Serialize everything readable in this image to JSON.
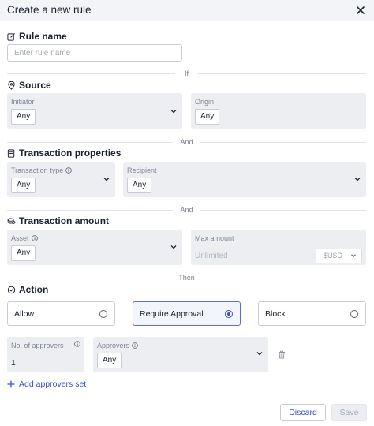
{
  "header": {
    "title": "Create a new rule"
  },
  "rule_name": {
    "title": "Rule name",
    "placeholder": "Enter rule name",
    "value": ""
  },
  "dividers": {
    "if": "If",
    "and1": "And",
    "and2": "And",
    "then": "Then"
  },
  "source": {
    "title": "Source",
    "initiator": {
      "label": "Initiator",
      "value": "Any"
    },
    "origin": {
      "label": "Origin",
      "value": "Any"
    }
  },
  "transaction_properties": {
    "title": "Transaction properties",
    "type": {
      "label": "Transaction type",
      "value": "Any"
    },
    "recipient": {
      "label": "Recipient",
      "value": "Any"
    }
  },
  "transaction_amount": {
    "title": "Transaction amount",
    "asset": {
      "label": "Asset",
      "value": "Any"
    },
    "max_amount": {
      "label": "Max amount",
      "placeholder": "Unlimited",
      "currency": "$USD"
    }
  },
  "action": {
    "title": "Action",
    "options": [
      "Allow",
      "Require Approval",
      "Block"
    ],
    "selected": "Require Approval"
  },
  "approvers": {
    "count_label": "No. of approvers",
    "count_value": "1",
    "approvers_label": "Approvers",
    "approvers_value": "Any",
    "add_label": "Add approvers set"
  },
  "footer": {
    "discard": "Discard",
    "save": "Save"
  },
  "colors": {
    "accent": "#3a4fc8",
    "field_bg": "#edeef2",
    "header_bg": "#f3f4f7"
  }
}
